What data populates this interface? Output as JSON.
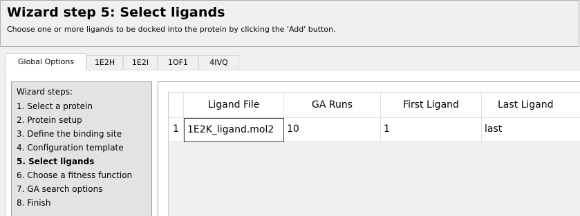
{
  "wizard": {
    "title": "Wizard step 5: Select ligands",
    "subtitle": "Choose one or more ligands to be docked into the protein by clicking the 'Add' button."
  },
  "tabs": [
    {
      "label": "Global Options",
      "active": true
    },
    {
      "label": "1E2H",
      "active": false
    },
    {
      "label": "1E2I",
      "active": false
    },
    {
      "label": "1OF1",
      "active": false
    },
    {
      "label": "4IVQ",
      "active": false
    }
  ],
  "steps": {
    "heading": "Wizard steps:",
    "items": [
      {
        "label": "1. Select a protein",
        "current": false
      },
      {
        "label": "2. Protein setup",
        "current": false
      },
      {
        "label": "3. Define the binding site",
        "current": false
      },
      {
        "label": "4. Configuration template",
        "current": false
      },
      {
        "label": "5. Select ligands",
        "current": true
      },
      {
        "label": "6. Choose a fitness function",
        "current": false
      },
      {
        "label": "7. GA search options",
        "current": false
      },
      {
        "label": "8. Finish",
        "current": false
      }
    ]
  },
  "ligand_table": {
    "columns": [
      "Ligand File",
      "GA Runs",
      "First Ligand",
      "Last Ligand"
    ],
    "rows": [
      {
        "number": "1",
        "cells": [
          "1E2K_ligand.mol2",
          "10",
          "1",
          "last"
        ]
      }
    ]
  }
}
